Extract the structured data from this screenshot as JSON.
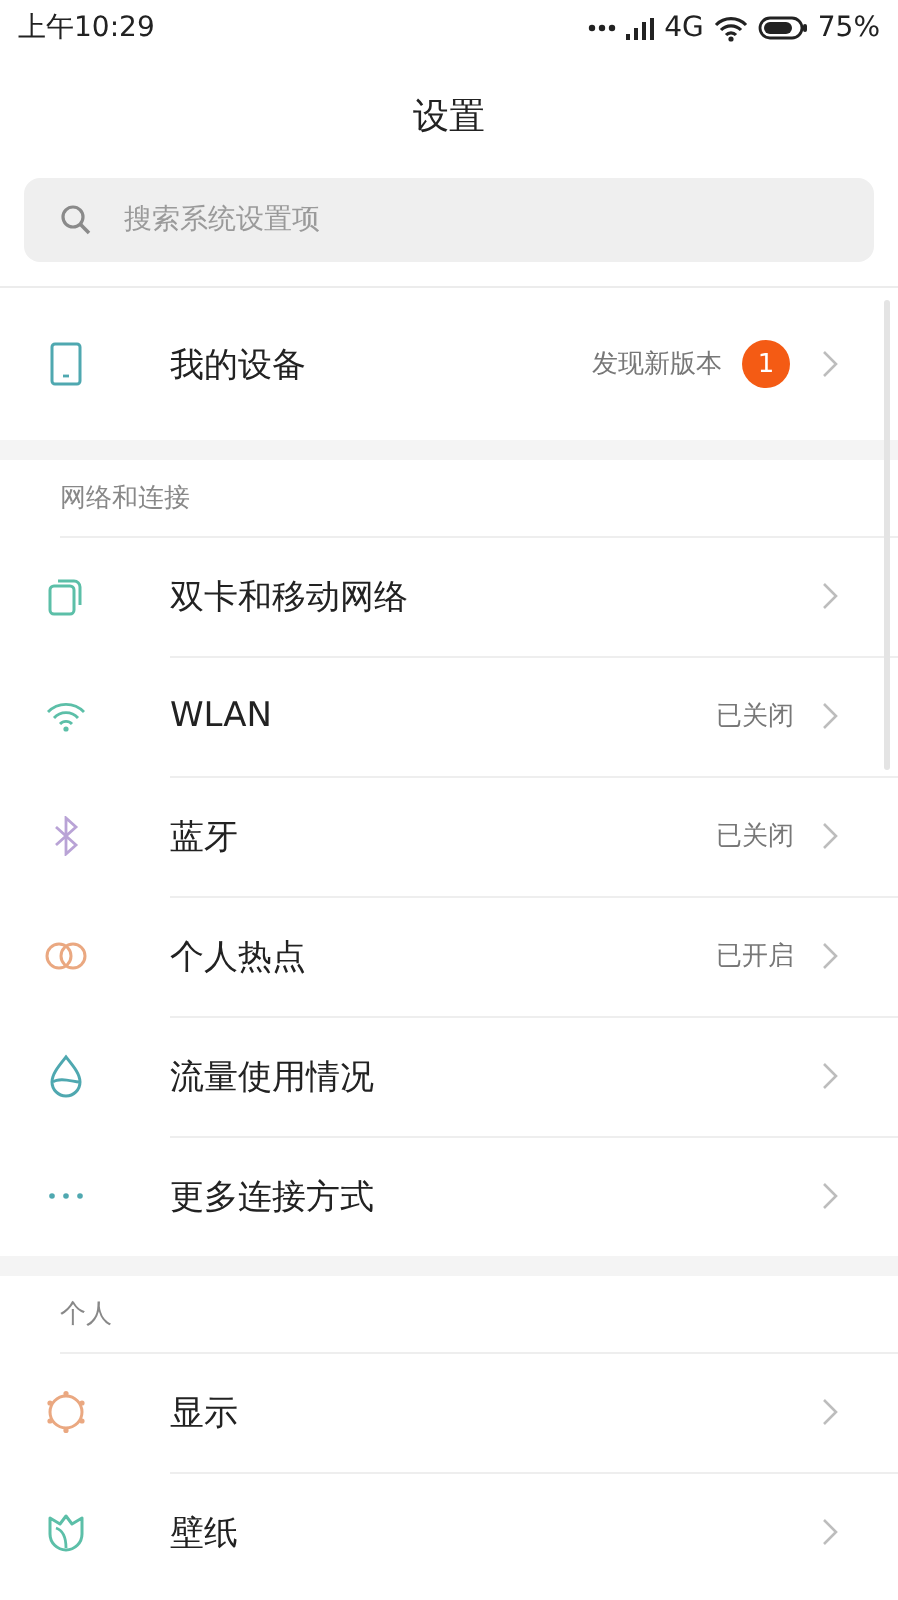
{
  "status_bar": {
    "time": "上午10:29",
    "network": "4G",
    "battery": "75%"
  },
  "title": "设置",
  "search": {
    "placeholder": "搜索系统设置项"
  },
  "device": {
    "label": "我的设备",
    "note": "发现新版本",
    "badge": "1"
  },
  "sections": [
    {
      "header": "网络和连接",
      "items": [
        {
          "kind": "sim",
          "label": "双卡和移动网络"
        },
        {
          "kind": "wifi",
          "label": "WLAN",
          "value": "已关闭"
        },
        {
          "kind": "bluetooth",
          "label": "蓝牙",
          "value": "已关闭"
        },
        {
          "kind": "hotspot",
          "label": "个人热点",
          "value": "已开启"
        },
        {
          "kind": "data",
          "label": "流量使用情况"
        },
        {
          "kind": "more",
          "label": "更多连接方式"
        }
      ]
    },
    {
      "header": "个人",
      "items": [
        {
          "kind": "display",
          "label": "显示"
        },
        {
          "kind": "wallpaper",
          "label": "壁纸"
        }
      ]
    }
  ]
}
